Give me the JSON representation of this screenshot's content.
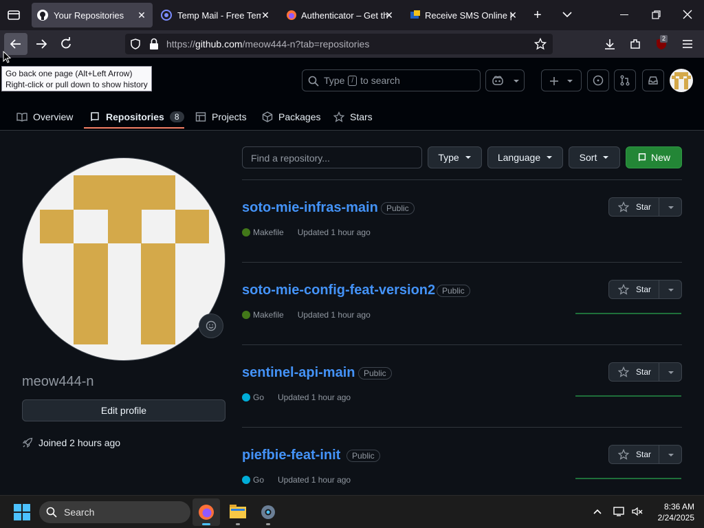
{
  "tabs": [
    {
      "label": "Your Repositories",
      "active": true
    },
    {
      "label": "Temp Mail - Free Temp"
    },
    {
      "label": "Authenticator – Get thi"
    },
    {
      "label": "Receive SMS Online | Te"
    }
  ],
  "nav": {
    "url_host_prefix": "https://",
    "url_host": "github.com",
    "url_path": "/meow444-n?tab=repositories",
    "downloads_badge": "2"
  },
  "tooltip": {
    "line1": "Go back one page (Alt+Left Arrow)",
    "line2": "Right-click or pull down to show history"
  },
  "header": {
    "search_prefix": "Type",
    "search_key": "/",
    "search_suffix": "to search"
  },
  "user_tabs": [
    {
      "label": "Overview"
    },
    {
      "label": "Repositories",
      "count": "8",
      "selected": true
    },
    {
      "label": "Projects"
    },
    {
      "label": "Packages"
    },
    {
      "label": "Stars"
    }
  ],
  "profile": {
    "username": "meow444-n",
    "edit_label": "Edit profile",
    "joined": "Joined 2 hours ago"
  },
  "filters": {
    "find_placeholder": "Find a repository...",
    "type_label": "Type",
    "language_label": "Language",
    "sort_label": "Sort",
    "new_label": "New"
  },
  "repos": [
    {
      "name": "soto-mie-infras-main",
      "visibility": "Public",
      "language": "Makefile",
      "lang_color": "#427819",
      "updated": "Updated 1 hour ago",
      "star_label": "Star"
    },
    {
      "name": "soto-mie-config-feat-version2",
      "visibility": "Public",
      "language": "Makefile",
      "lang_color": "#427819",
      "updated": "Updated 1 hour ago",
      "star_label": "Star"
    },
    {
      "name": "sentinel-api-main",
      "visibility": "Public",
      "language": "Go",
      "lang_color": "#00ADD8",
      "updated": "Updated 1 hour ago",
      "star_label": "Star"
    },
    {
      "name": "piefbie-feat-init",
      "visibility": "Public",
      "language": "Go",
      "lang_color": "#00ADD8",
      "updated": "Updated 1 hour ago",
      "star_label": "Star"
    }
  ],
  "taskbar": {
    "search_label": "Search",
    "time": "8:36 AM",
    "date": "2/24/2025"
  },
  "colors": {
    "accent_green": "#238636",
    "link_blue": "#4493f8",
    "avatar_gold": "#d4a94a",
    "avatar_bg": "#f2f2f2"
  }
}
